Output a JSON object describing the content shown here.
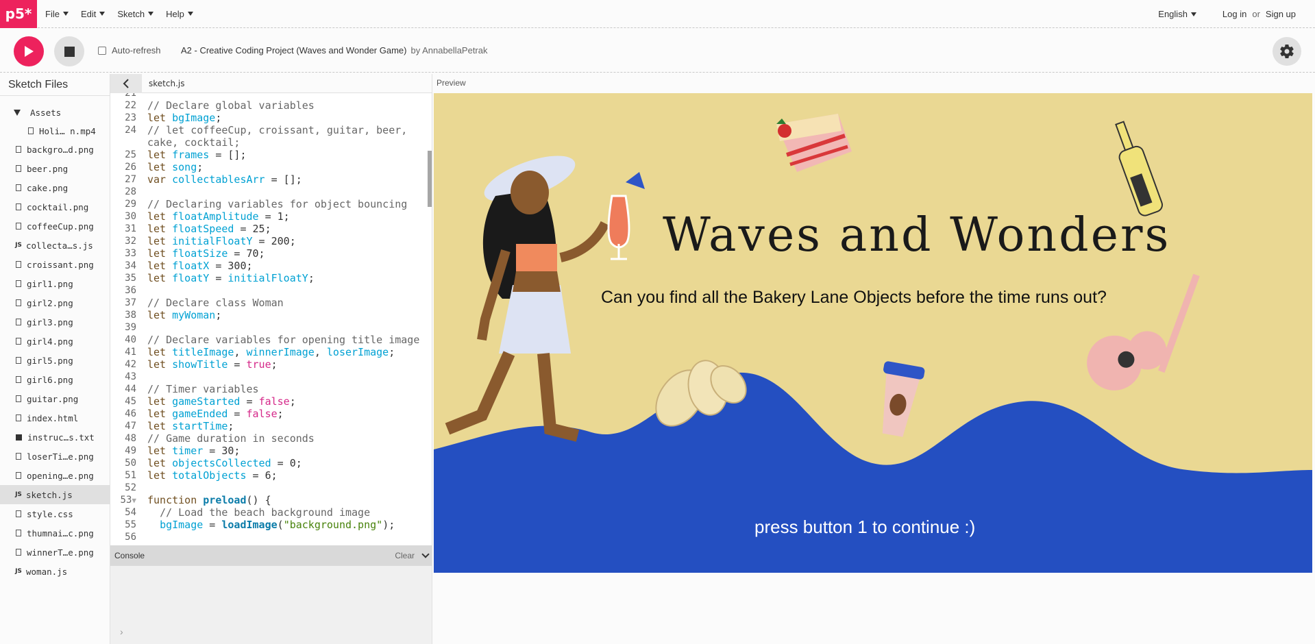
{
  "app": {
    "logo": "p5*"
  },
  "menu": [
    {
      "label": "File"
    },
    {
      "label": "Edit"
    },
    {
      "label": "Sketch"
    },
    {
      "label": "Help"
    }
  ],
  "nav": {
    "language": "English",
    "login": "Log in",
    "or": "or",
    "signup": "Sign up"
  },
  "toolbar": {
    "autorefresh_label": "Auto-refresh",
    "sketch_name": "A2 - Creative Coding Project (Waves and Wonder Game)",
    "by": "by AnnabellaPetrak"
  },
  "sidebar": {
    "title": "Sketch Files",
    "folder": "Assets",
    "folder_file": "Holi… n.mp4",
    "files": [
      {
        "name": "backgro…d.png",
        "type": "doc"
      },
      {
        "name": "beer.png",
        "type": "doc"
      },
      {
        "name": "cake.png",
        "type": "doc"
      },
      {
        "name": "cocktail.png",
        "type": "doc"
      },
      {
        "name": "coffeeCup.png",
        "type": "doc"
      },
      {
        "name": "collecta…s.js",
        "type": "js"
      },
      {
        "name": "croissant.png",
        "type": "doc"
      },
      {
        "name": "girl1.png",
        "type": "doc"
      },
      {
        "name": "girl2.png",
        "type": "doc"
      },
      {
        "name": "girl3.png",
        "type": "doc"
      },
      {
        "name": "girl4.png",
        "type": "doc"
      },
      {
        "name": "girl5.png",
        "type": "doc"
      },
      {
        "name": "girl6.png",
        "type": "doc"
      },
      {
        "name": "guitar.png",
        "type": "doc"
      },
      {
        "name": "index.html",
        "type": "doc"
      },
      {
        "name": "instruc…s.txt",
        "type": "sq"
      },
      {
        "name": "loserTi…e.png",
        "type": "doc"
      },
      {
        "name": "opening…e.png",
        "type": "doc"
      },
      {
        "name": "sketch.js",
        "type": "js",
        "active": true
      },
      {
        "name": "style.css",
        "type": "doc"
      },
      {
        "name": "thumnai…c.png",
        "type": "doc"
      },
      {
        "name": "winnerT…e.png",
        "type": "doc"
      },
      {
        "name": "woman.js",
        "type": "js"
      }
    ]
  },
  "editor": {
    "tab": "sketch.js"
  },
  "console": {
    "label": "Console",
    "clear": "Clear",
    "prompt": "›"
  },
  "preview": {
    "label": "Preview",
    "title": "Waves and Wonders",
    "subtitle": "Can you find all the Bakery Lane Objects before the time runs out?",
    "press": "press button 1 to continue :)"
  },
  "colors": {
    "accent": "#ed225d",
    "sand": "#ead893",
    "wave": "#244fc1"
  }
}
